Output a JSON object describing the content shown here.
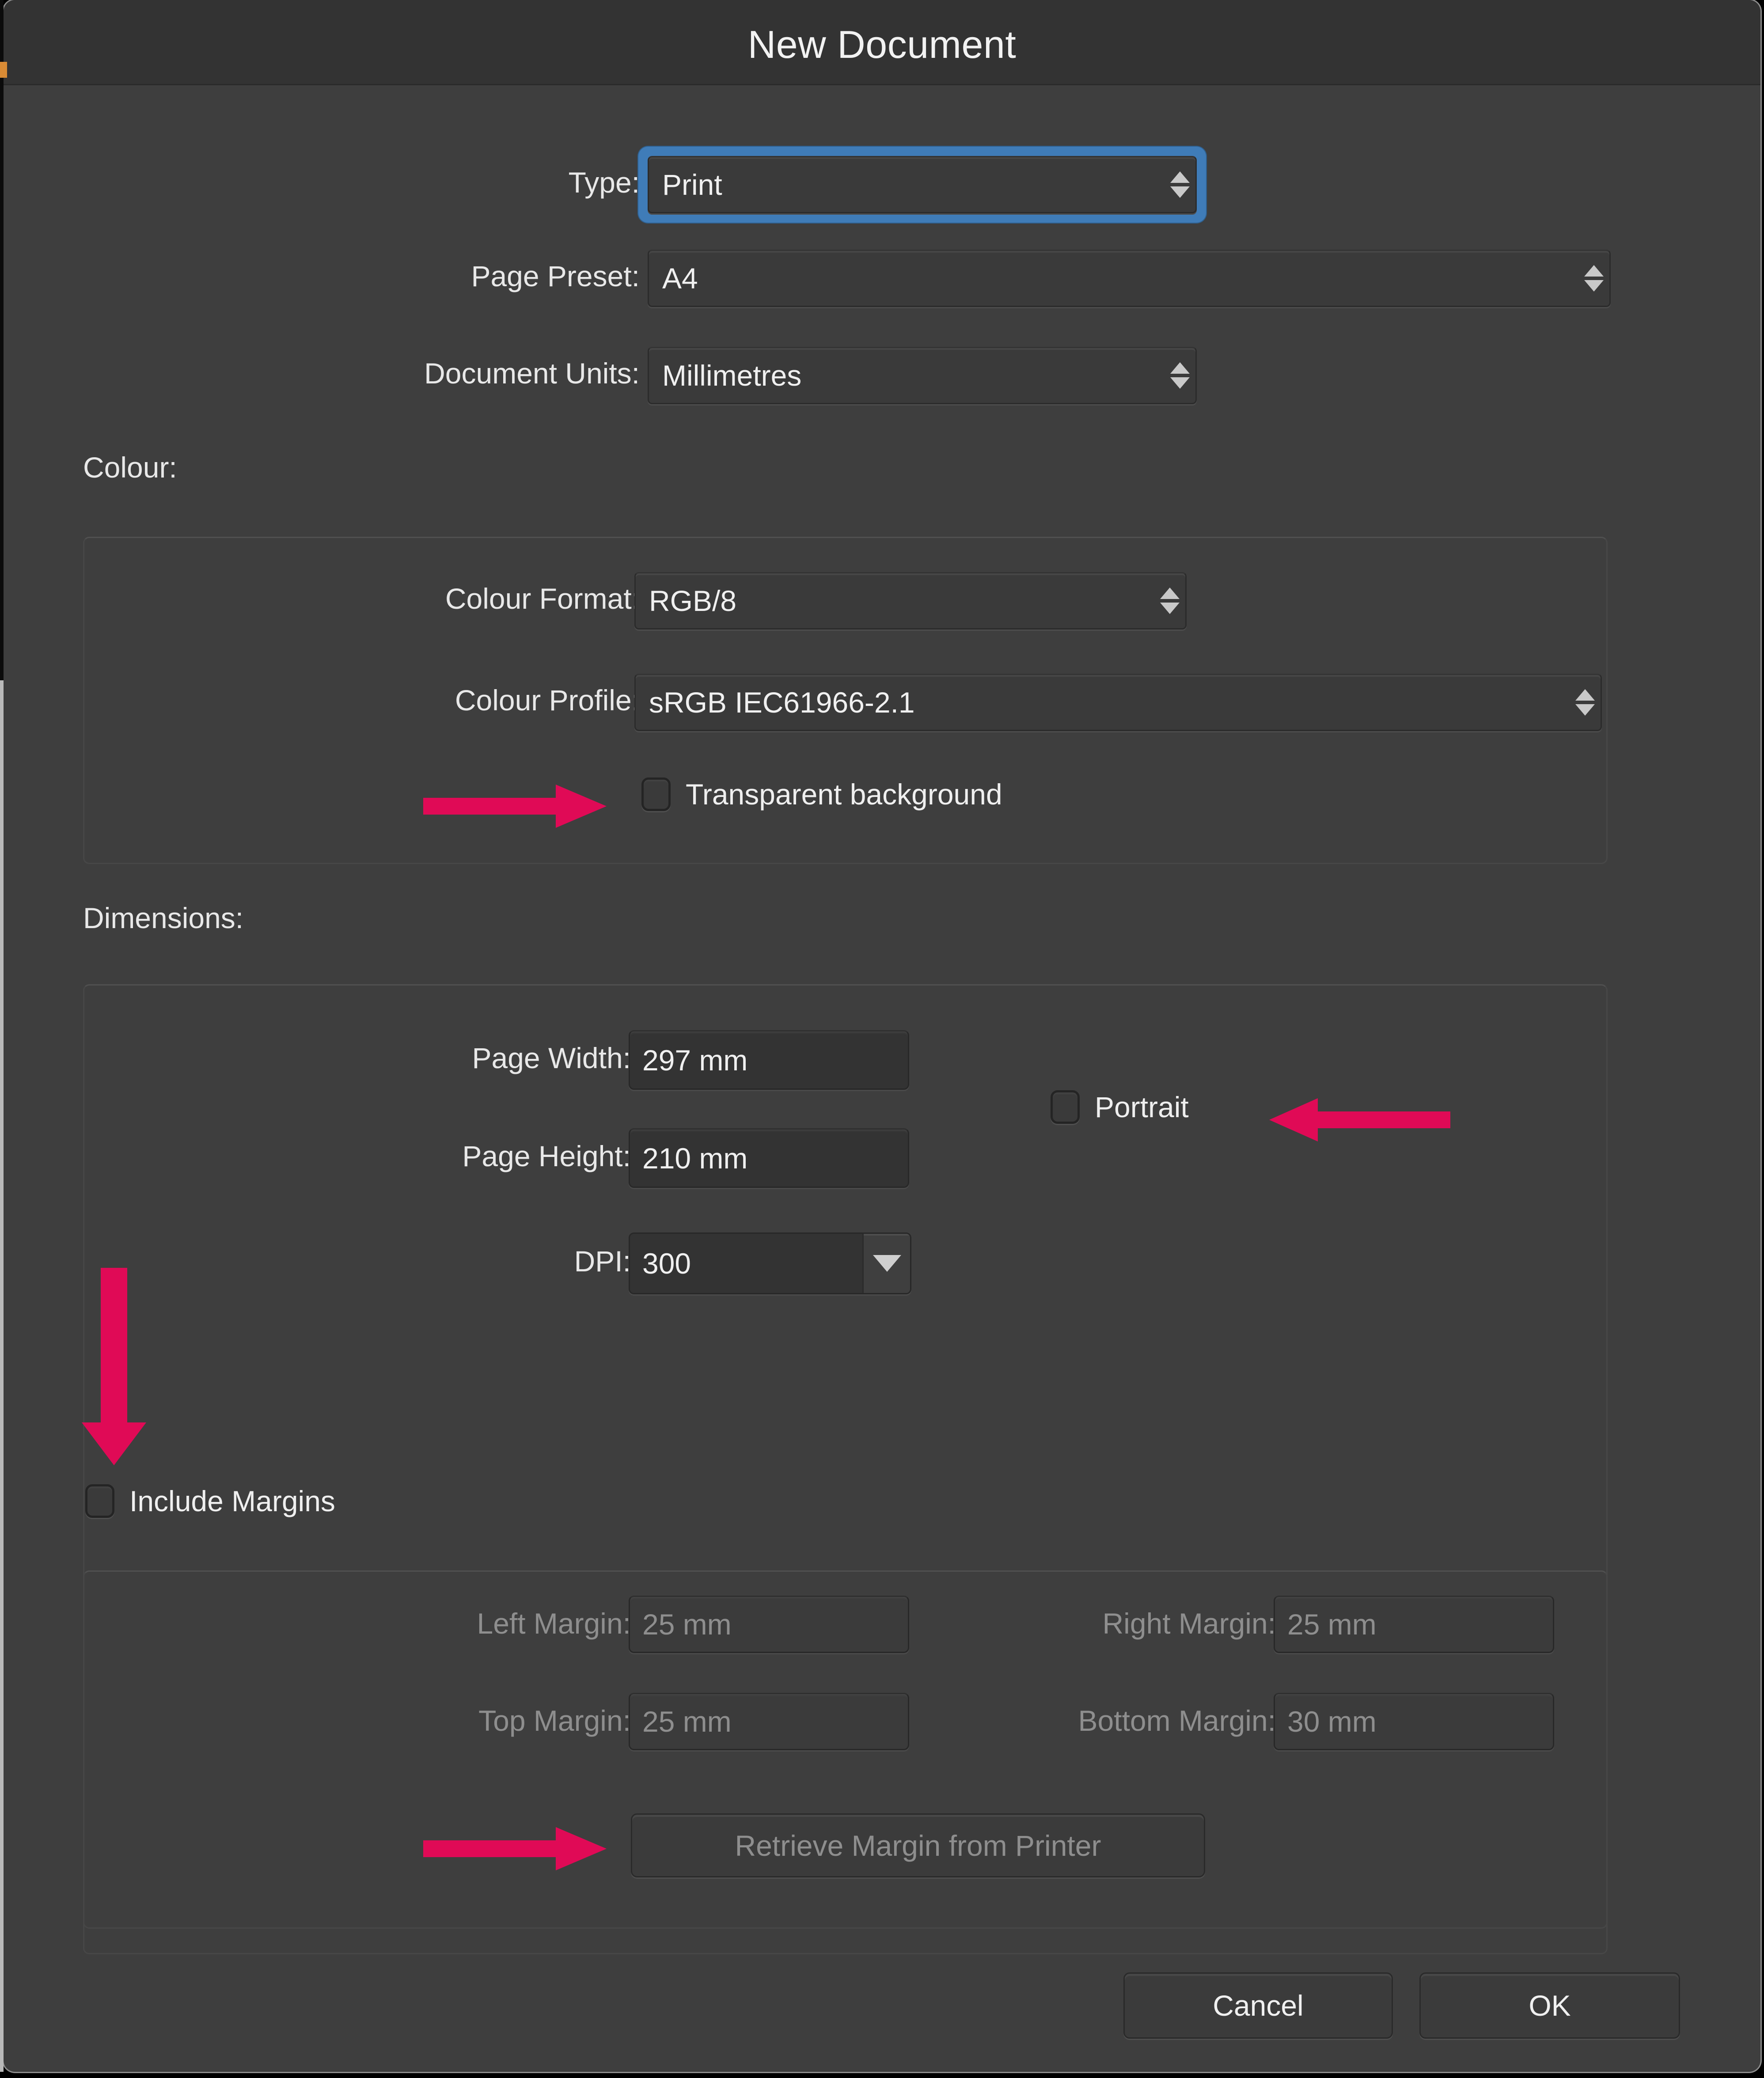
{
  "window": {
    "title": "New Document"
  },
  "fields": {
    "type_label": "Type:",
    "type_value": "Print",
    "page_preset_label": "Page Preset:",
    "page_preset_value": "A4",
    "document_units_label": "Document Units:",
    "document_units_value": "Millimetres"
  },
  "colour": {
    "section_label": "Colour:",
    "format_label": "Colour Format:",
    "format_value": "RGB/8",
    "profile_label": "Colour Profile:",
    "profile_value": "sRGB IEC61966-2.1",
    "transparent_label": "Transparent background",
    "transparent_checked": false
  },
  "dimensions": {
    "section_label": "Dimensions:",
    "page_width_label": "Page Width:",
    "page_width_value": "297 mm",
    "page_height_label": "Page Height:",
    "page_height_value": "210 mm",
    "dpi_label": "DPI:",
    "dpi_value": "300",
    "portrait_label": "Portrait",
    "portrait_checked": false
  },
  "margins": {
    "include_label": "Include Margins",
    "include_checked": false,
    "left_label": "Left Margin:",
    "left_value": "25 mm",
    "right_label": "Right Margin:",
    "right_value": "25 mm",
    "top_label": "Top Margin:",
    "top_value": "25 mm",
    "bottom_label": "Bottom Margin:",
    "bottom_value": "30 mm",
    "retrieve_label": "Retrieve Margin from Printer"
  },
  "footer": {
    "cancel_label": "Cancel",
    "ok_label": "OK"
  },
  "annotations": {
    "color": "#e00a56",
    "arrows": [
      {
        "name": "arrow-to-transparent-background",
        "direction": "right"
      },
      {
        "name": "arrow-to-portrait",
        "direction": "left"
      },
      {
        "name": "arrow-to-include-margins",
        "direction": "down"
      },
      {
        "name": "arrow-to-retrieve-margin-button",
        "direction": "right"
      }
    ]
  },
  "colors": {
    "dialog_bg": "#3e3e3e",
    "titlebar_bg": "#333333",
    "focus_ring": "#3f7cb8",
    "annotation": "#e00a56",
    "text": "#efefef",
    "disabled_text": "#8e8e8e"
  }
}
